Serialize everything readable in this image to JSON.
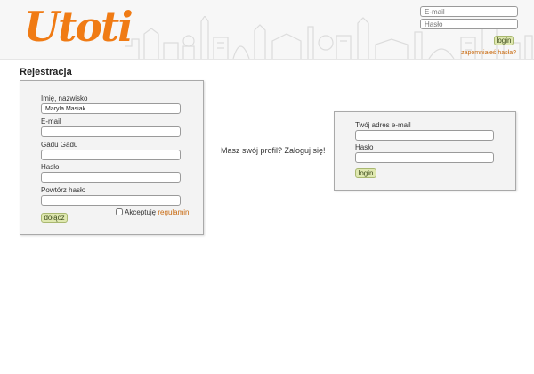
{
  "header": {
    "logo_text": "Utoti",
    "email_placeholder": "E-mail",
    "password_placeholder": "Hasło",
    "login_label": "login",
    "forgot_label": "zapomniałeś hasła?"
  },
  "registration": {
    "title": "Rejestracja",
    "name_label": "Imię, nazwisko",
    "name_value": "Maryla Masiak",
    "email_label": "E-mail",
    "gg_label": "Gadu Gadu",
    "password_label": "Hasło",
    "repeat_password_label": "Powtórz hasło",
    "join_label": "dołącz",
    "accept_label": "Akceptuję",
    "terms_label": "regulamin"
  },
  "middle_text": "Masz swój profil? Zaloguj się!",
  "login_panel": {
    "email_label": "Twój adres e-mail",
    "password_label": "Hasło",
    "login_label": "login"
  },
  "colors": {
    "accent": "#f07b14",
    "button_bg": "#dfe8b0",
    "link": "#c8690e"
  }
}
